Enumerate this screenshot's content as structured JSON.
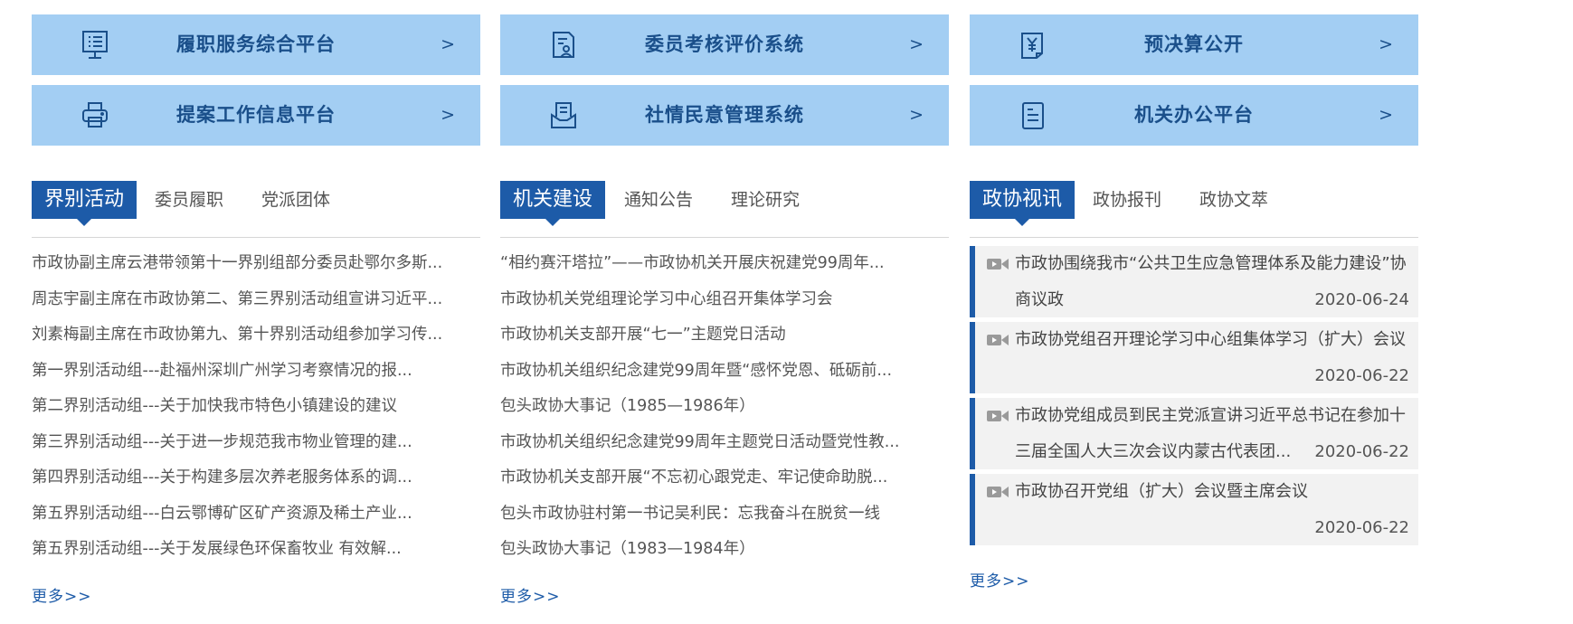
{
  "cards": [
    {
      "label": "履职服务综合平台",
      "icon": "monitor-icon"
    },
    {
      "label": "委员考核评价系统",
      "icon": "document-user-icon"
    },
    {
      "label": "预决算公开",
      "icon": "budget-document-icon"
    },
    {
      "label": "提案工作信息平台",
      "icon": "printer-icon"
    },
    {
      "label": "社情民意管理系统",
      "icon": "inbox-document-icon"
    },
    {
      "label": "机关办公平台",
      "icon": "file-icon"
    }
  ],
  "arrow": ">",
  "sections": [
    {
      "tabs": [
        "界别活动",
        "委员履职",
        "党派团体"
      ],
      "items": [
        "市政协副主席云港带领第十一界别组部分委员赴鄂尔多斯...",
        "周志宇副主席在市政协第二、第三界别活动组宣讲习近平...",
        "刘素梅副主席在市政协第九、第十界别活动组参加学习传...",
        "第一界别活动组---赴福州深圳广州学习考察情况的报...",
        "第二界别活动组---关于加快我市特色小镇建设的建议",
        "第三界别活动组---关于进一步规范我市物业管理的建...",
        "第四界别活动组---关于构建多层次养老服务体系的调...",
        "第五界别活动组---白云鄂博矿区矿产资源及稀土产业...",
        "第五界别活动组---关于发展绿色环保畜牧业 有效解..."
      ],
      "more": "更多>>"
    },
    {
      "tabs": [
        "机关建设",
        "通知公告",
        "理论研究"
      ],
      "items": [
        "“相约赛汗塔拉”——市政协机关开展庆祝建党99周年...",
        "市政协机关党组理论学习中心组召开集体学习会",
        "市政协机关支部开展“七一”主题党日活动",
        "市政协机关组织纪念建党99周年暨“感怀党恩、砥砺前...",
        "包头政协大事记（1985—1986年）",
        "市政协机关组织纪念建党99周年主题党日活动暨党性教...",
        "市政协机关支部开展“不忘初心跟党走、牢记使命助脱...",
        "包头市政协驻村第一书记吴利民：忘我奋斗在脱贫一线",
        "包头政协大事记（1983—1984年）"
      ],
      "more": "更多>>"
    },
    {
      "tabs": [
        "政协视讯",
        "政协报刊",
        "政协文萃"
      ],
      "videos": [
        {
          "title": "市政协围绕我市“公共卫生应急管理体系及能力建设”协商议政",
          "date": "2020-06-24"
        },
        {
          "title": "市政协党组召开理论学习中心组集体学习（扩大）会议",
          "date": "2020-06-22"
        },
        {
          "title": "市政协党组成员到民主党派宣讲习近平总书记在参加十三届全国人大三次会议内蒙古代表团...",
          "date": "2020-06-22"
        },
        {
          "title": "市政协召开党组（扩大）会议暨主席会议",
          "date": "2020-06-22"
        }
      ],
      "more": "更多>>"
    }
  ]
}
